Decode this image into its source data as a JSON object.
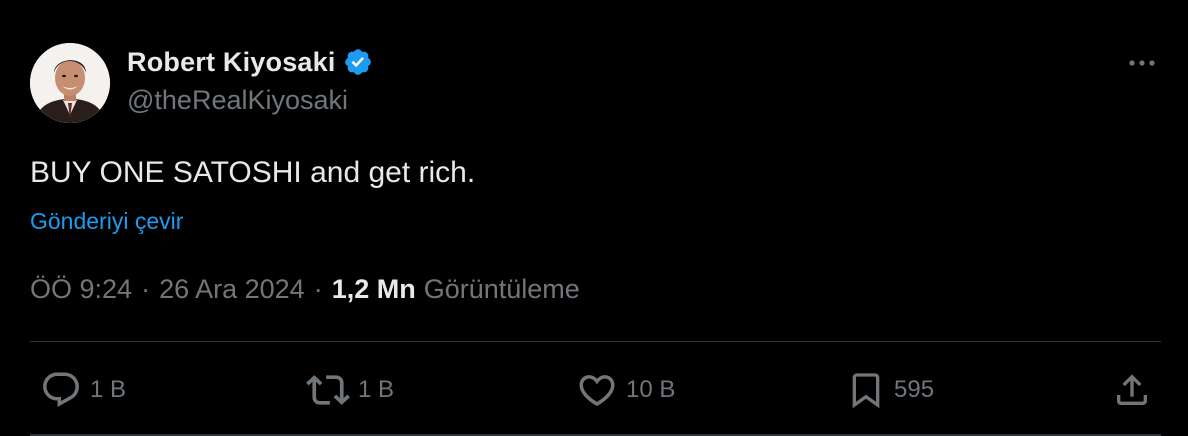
{
  "author": {
    "display_name": "Robert Kiyosaki",
    "handle": "@theRealKiyosaki",
    "verified": true,
    "verified_badge_color": "#1d9bf0"
  },
  "tweet": {
    "text": "BUY ONE SATOSHI and get rich.",
    "translate_label": "Gönderiyi çevir"
  },
  "meta": {
    "time": "ÖÖ 9:24",
    "separator": "·",
    "date": "26 Ara 2024",
    "views_count": "1,2 Mn",
    "views_label": "Görüntüleme"
  },
  "actions": {
    "reply": {
      "icon": "reply-icon",
      "count": "1 B"
    },
    "repost": {
      "icon": "repost-icon",
      "count": "1 B"
    },
    "like": {
      "icon": "heart-icon",
      "count": "10 B"
    },
    "bookmark": {
      "icon": "bookmark-icon",
      "count": "595"
    },
    "share": {
      "icon": "share-icon"
    }
  },
  "colors": {
    "background": "#000000",
    "primary_text": "#e7e9ea",
    "secondary_text": "#71767b",
    "link": "#1d9bf0",
    "divider": "#2f3336"
  }
}
